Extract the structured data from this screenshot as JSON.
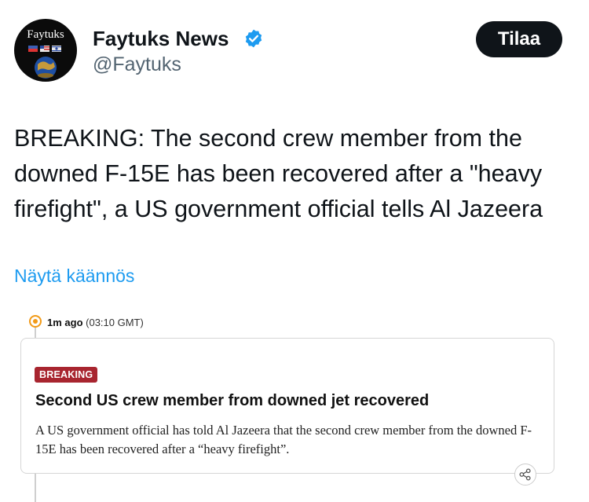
{
  "author": {
    "avatar_text": "Faytuks",
    "name": "Faytuks News",
    "handle": "@Faytuks",
    "verified": true
  },
  "header": {
    "subscribe_label": "Tilaa"
  },
  "tweet": {
    "text": "BREAKING: The second crew member from the\ndowned F-15E has been recovered after a \"heavy\nfirefight\", a US government official tells Al Jazeera",
    "translate_link": "Näytä käännös"
  },
  "embed": {
    "time_ago": "1m ago",
    "time_gmt": "(03:10 GMT)",
    "badge": "BREAKING",
    "headline": "Second US crew member from downed jet recovered",
    "body": "A US government official has told Al Jazeera that the second crew member from the downed F-15E has been recovered after a “heavy firefight”."
  },
  "colors": {
    "accent": "#1d9bf0",
    "breaking_badge": "#a8252f",
    "live_dot": "#f29a17",
    "subscribe_bg": "#0f1419"
  },
  "icons": [
    "verified-badge-icon",
    "live-indicator-icon",
    "share-icon"
  ]
}
